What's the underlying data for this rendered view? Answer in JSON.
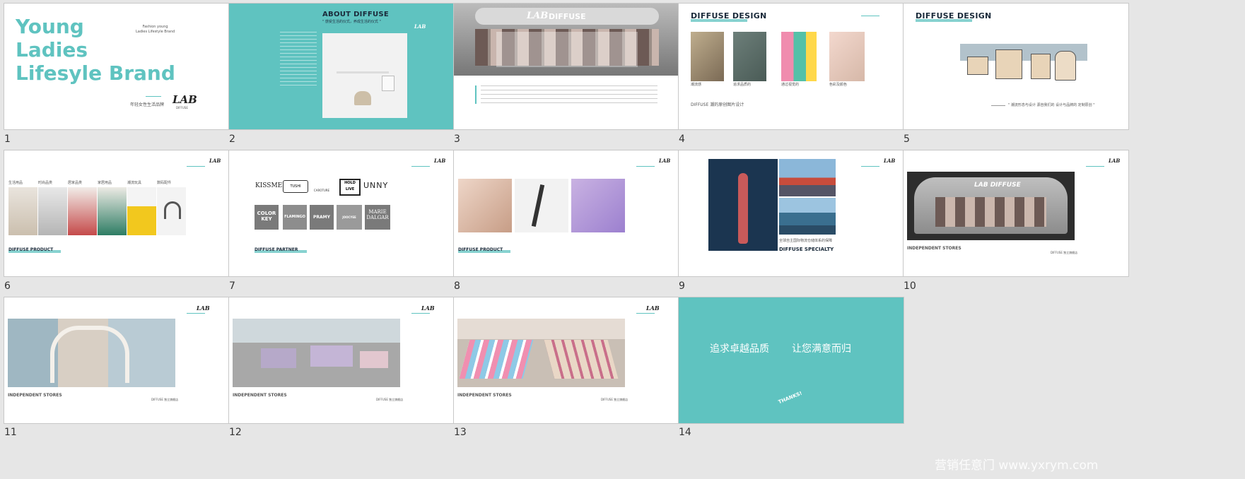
{
  "slides": [
    {
      "n": "1",
      "title_lines": [
        "Young",
        "Ladies",
        "Lifesyle Brand"
      ],
      "tagline": "Fashion young\nLadies Lifestyle Brand",
      "subtitle": "年轻女性生活品牌",
      "logo": "LAB",
      "logo_sub": "DIFFUSE"
    },
    {
      "n": "2",
      "heading": "ABOUT DIFFUSE",
      "sub": "\" 感受生活的仪式，养成生活的仪式 \"",
      "logo": "LAB"
    },
    {
      "n": "3",
      "logo": "LAB",
      "brand": "DIFFUSE"
    },
    {
      "n": "4",
      "heading": "DIFFUSE DESIGN",
      "captions": [
        "潮流感",
        "追求品质的",
        "通过视觉的",
        "色彩及颜色"
      ],
      "footer": "DIFFUSE 潮的原创图片设计"
    },
    {
      "n": "5",
      "heading": "DIFFUSE DESIGN",
      "quote": "\" 潮流形态与设计 源自我们的 设计与品牌的 定制原创 \""
    },
    {
      "n": "6",
      "labels": [
        "生活用品",
        "时尚品类",
        "居家品类",
        "家居用品",
        "潮流玩具",
        "数码配件"
      ],
      "footer": "DIFFUSE PRODUCT",
      "logo": "LAB"
    },
    {
      "n": "7",
      "brands": [
        "KISSME",
        "TUSHI",
        "CAROTURE",
        "HOLD LIVE",
        "UNNY"
      ],
      "brands2": [
        "COLOR KEY",
        "FLAMINGO",
        "PRAMY",
        "JOOCYEE",
        "MARIE DALGAR"
      ],
      "footer": "DIFFUSE PARTNER",
      "logo": "LAB"
    },
    {
      "n": "8",
      "footer": "DIFFUSE PRODUCT",
      "logo": "LAB"
    },
    {
      "n": "9",
      "caption": "全球自主国际物流仓储体系的保障",
      "footer": "DIFFUSE SPECIALTY",
      "logo": "LAB"
    },
    {
      "n": "10",
      "footer": "INDEPENDENT STORES",
      "brand": "LAB DIFFUSE",
      "logo": "LAB",
      "note": "DIFFUSE 独立旗舰店"
    },
    {
      "n": "11",
      "footer": "INDEPENDENT STORES",
      "logo": "LAB",
      "note": "DIFFUSE 独立旗舰店"
    },
    {
      "n": "12",
      "footer": "INDEPENDENT STORES",
      "logo": "LAB",
      "note": "DIFFUSE 独立旗舰店"
    },
    {
      "n": "13",
      "footer": "INDEPENDENT STORES",
      "logo": "LAB",
      "note": "DIFFUSE 独立旗舰店"
    },
    {
      "n": "14",
      "line1": "追求卓越品质",
      "line2": "让您满意而归",
      "thanks": "THANKS!"
    }
  ],
  "watermark": "营销任意门 www.yxrym.com",
  "colors": {
    "accent": "#5fc3c0",
    "bg": "#e6e6e6"
  }
}
